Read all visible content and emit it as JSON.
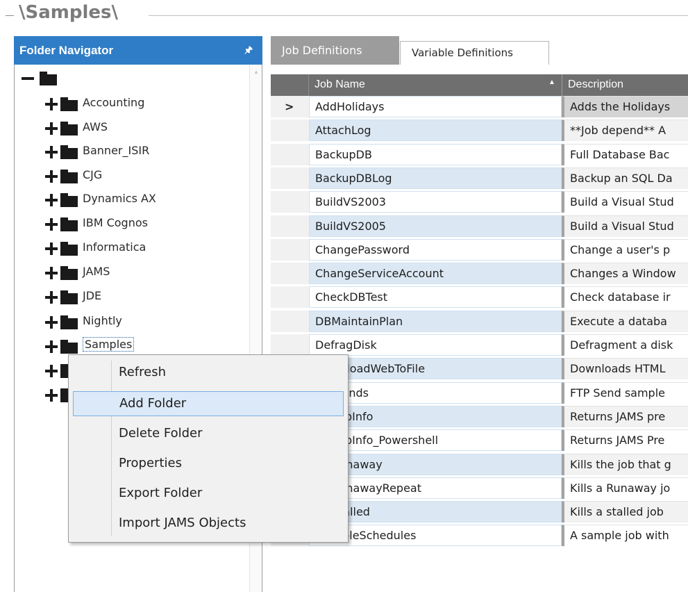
{
  "header": {
    "title": "\\Samples\\"
  },
  "navigator": {
    "title": "Folder Navigator",
    "pin_icon": "pin-icon",
    "root_label": "",
    "folders": [
      "Accounting",
      "AWS",
      "Banner_ISIR",
      "CJG",
      "Dynamics AX",
      "IBM Cognos",
      "Informatica",
      "JAMS",
      "JDE",
      "Nightly",
      "Samples"
    ],
    "selected_folder": "Samples"
  },
  "tabs": [
    {
      "label": "Job Definitions",
      "active": true
    },
    {
      "label": "Variable Definitions",
      "active": false
    }
  ],
  "grid": {
    "columns": {
      "job_name": "Job Name",
      "description": "Description"
    },
    "current_row_marker": ">",
    "rows": [
      {
        "name": "AddHolidays",
        "desc": "Adds the Holidays"
      },
      {
        "name": "AttachLog",
        "desc": "**Job depend** A"
      },
      {
        "name": "BackupDB",
        "desc": "Full Database Bac"
      },
      {
        "name": "BackupDBLog",
        "desc": "Backup an SQL Da"
      },
      {
        "name": "BuildVS2003",
        "desc": "Build a Visual Stud"
      },
      {
        "name": "BuildVS2005",
        "desc": "Build a Visual Stud"
      },
      {
        "name": "ChangePassword",
        "desc": "Change a user's p"
      },
      {
        "name": "ChangeServiceAccount",
        "desc": "Changes a Window"
      },
      {
        "name": "CheckDBTest",
        "desc": "Check database ir"
      },
      {
        "name": "DBMaintainPlan",
        "desc": "Execute a databa"
      },
      {
        "name": "DefragDisk",
        "desc": "Defragment a disk"
      },
      {
        "name": "DownloadWebToFile",
        "desc": "Downloads HTML"
      },
      {
        "name": "FTPSends",
        "desc": "FTP Send sample"
      },
      {
        "name": "GetJobInfo",
        "desc": "Returns JAMS pre"
      },
      {
        "name": "GetJobInfo_Powershell",
        "desc": "Returns JAMS Pre"
      },
      {
        "name": "KillRunaway",
        "desc": "Kills the job that g"
      },
      {
        "name": "KillRunawayRepeat",
        "desc": "Kills a Runaway jo"
      },
      {
        "name": "KillStalled",
        "desc": "Kills a stalled job"
      },
      {
        "name": "MultipleSchedules",
        "desc": "A sample job with"
      }
    ]
  },
  "context_menu": {
    "items": [
      "Refresh",
      "Add Folder",
      "Delete Folder",
      "Properties",
      "Export Folder",
      "Import JAMS Objects"
    ],
    "hovered": "Add Folder"
  }
}
